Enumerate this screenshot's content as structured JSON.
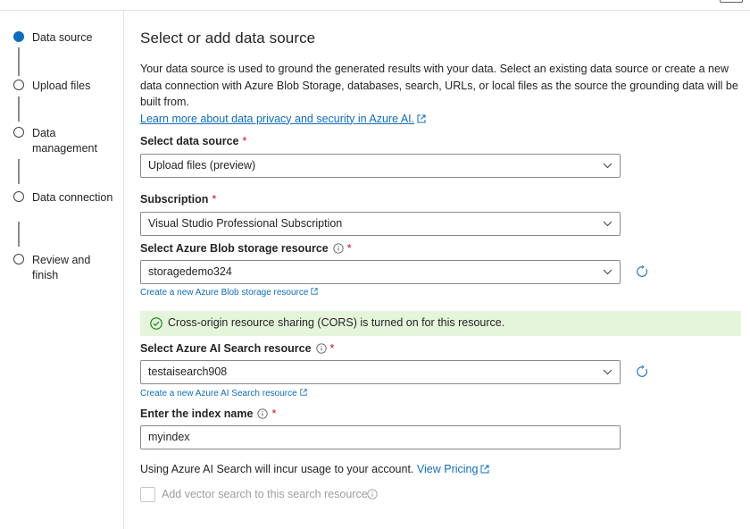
{
  "steps": [
    {
      "label": "Data source",
      "active": true
    },
    {
      "label": "Upload files",
      "active": false
    },
    {
      "label": "Data management",
      "active": false
    },
    {
      "label": "Data connection",
      "active": false
    },
    {
      "label": "Review and finish",
      "active": false
    }
  ],
  "page": {
    "title": "Select or add data source",
    "description": "Your data source is used to ground the generated results with your data. Select an existing data source or create a new data connection with Azure Blob Storage, databases, search, URLs, or local files as the source the grounding data will be built from.",
    "learn_more": "Learn more about data privacy and security in Azure AI."
  },
  "fields": {
    "data_source": {
      "label": "Select data source",
      "required": "*",
      "value": "Upload files (preview)"
    },
    "subscription": {
      "label": "Subscription",
      "required": "*",
      "value": "Visual Studio Professional Subscription"
    },
    "blob": {
      "label": "Select Azure Blob storage resource",
      "required": "*",
      "value": "storagedemo324",
      "create_link": "Create a new Azure Blob storage resource"
    },
    "cors_banner": "Cross-origin resource sharing (CORS) is turned on for this resource.",
    "search": {
      "label": "Select Azure AI Search resource",
      "required": "*",
      "value": "testaisearch908",
      "create_link": "Create a new Azure AI Search resource"
    },
    "index": {
      "label": "Enter the index name",
      "required": "*",
      "value": "myindex"
    }
  },
  "note": {
    "text": "Using Azure AI Search will incur usage to your account.",
    "link": "View Pricing"
  },
  "vector_checkbox": {
    "label": "Add vector search to this search resource.",
    "checked": false,
    "disabled": true
  },
  "colors": {
    "accent": "#0f6cbd",
    "required": "#c50f1f",
    "success_bg": "#e5f5dc",
    "success_icon": "#107c10"
  }
}
